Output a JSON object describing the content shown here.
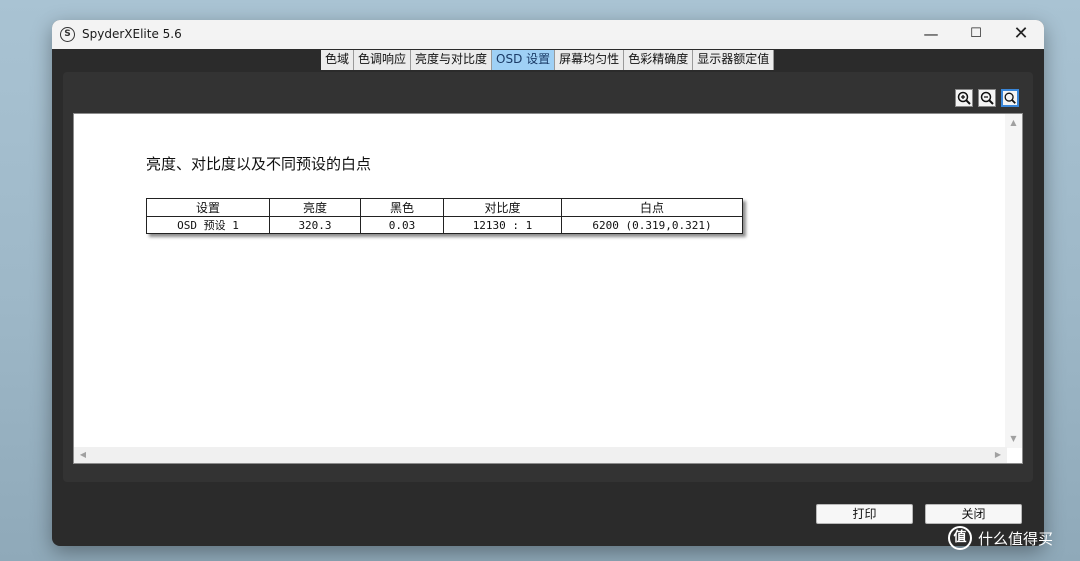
{
  "window": {
    "title": "SpyderXElite 5.6",
    "app_icon_letter": "S",
    "minimize_glyph": "—",
    "maximize_glyph": "☐",
    "close_glyph": "✕"
  },
  "tabs": [
    {
      "label": "色域",
      "active": false
    },
    {
      "label": "色调响应",
      "active": false
    },
    {
      "label": "亮度与对比度",
      "active": false
    },
    {
      "label": "OSD 设置",
      "active": true
    },
    {
      "label": "屏幕均匀性",
      "active": false
    },
    {
      "label": "色彩精确度",
      "active": false
    },
    {
      "label": "显示器额定值",
      "active": false
    }
  ],
  "zoom": {
    "zoom_in_icon": "zoom-in-icon",
    "zoom_out_icon": "zoom-out-icon",
    "zoom_fit_icon": "zoom-fit-icon"
  },
  "report": {
    "title": "亮度、对比度以及不同预设的白点",
    "columns": [
      "设置",
      "亮度",
      "黑色",
      "对比度",
      "白点"
    ],
    "rows": [
      [
        "OSD 预设 1",
        "320.3",
        "0.03",
        "12130 : 1",
        "6200 (0.319,0.321)"
      ]
    ]
  },
  "buttons": {
    "print": "打印",
    "close": "关闭"
  },
  "watermark": {
    "logo": "值",
    "text": "什么值得买"
  },
  "colors": {
    "active_tab": "#9fd0f5",
    "window_bg": "#2b2b2b",
    "page_bg": "#ffffff"
  }
}
